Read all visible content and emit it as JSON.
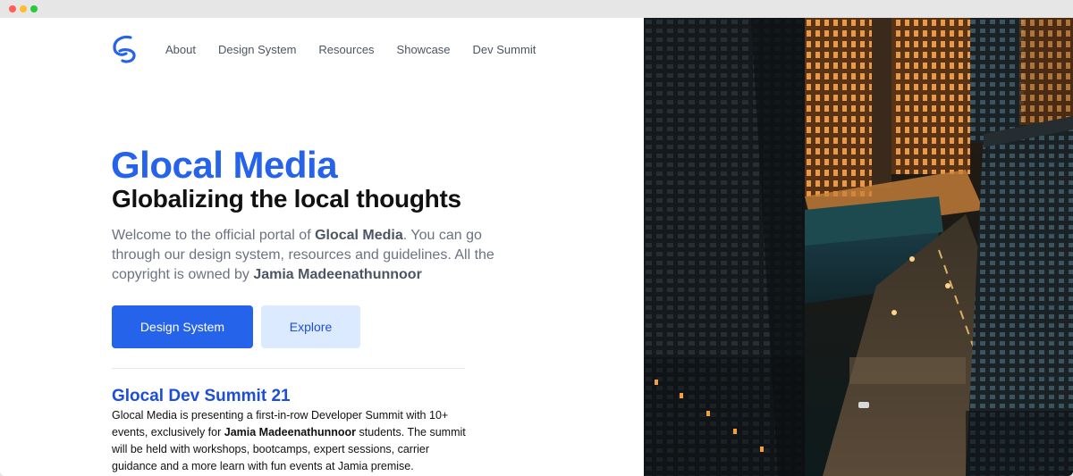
{
  "nav": {
    "items": [
      "About",
      "Design System",
      "Resources",
      "Showcase",
      "Dev Summit"
    ]
  },
  "hero": {
    "brand": "Glocal Media",
    "tagline": "Globalizing the local thoughts",
    "intro_1": "Welcome to the official portal of ",
    "intro_brand": "Glocal Media",
    "intro_2": ". You can go through our design system, resources and guidelines. All the copyright is owned by ",
    "intro_owner": "Jamia Madeenathunnoor",
    "primary_button": "Design System",
    "secondary_button": "Explore"
  },
  "summit": {
    "title": "Glocal Dev Summit 21",
    "body_1": "Glocal Media is presenting a first-in-row Developer Summit with 10+ events, exclusively for ",
    "body_owner": "Jamia Madeenathunnoor",
    "body_2": " students. The summit will be held with workshops, bootcamps, expert sessions, carrier guidance and a more learn with fun events at Jamia premise."
  },
  "colors": {
    "accent": "#2563eb",
    "accent_light": "#dbeafe",
    "text_muted": "#6b7280"
  },
  "icons": {
    "logo": "glocal-logo-icon"
  }
}
